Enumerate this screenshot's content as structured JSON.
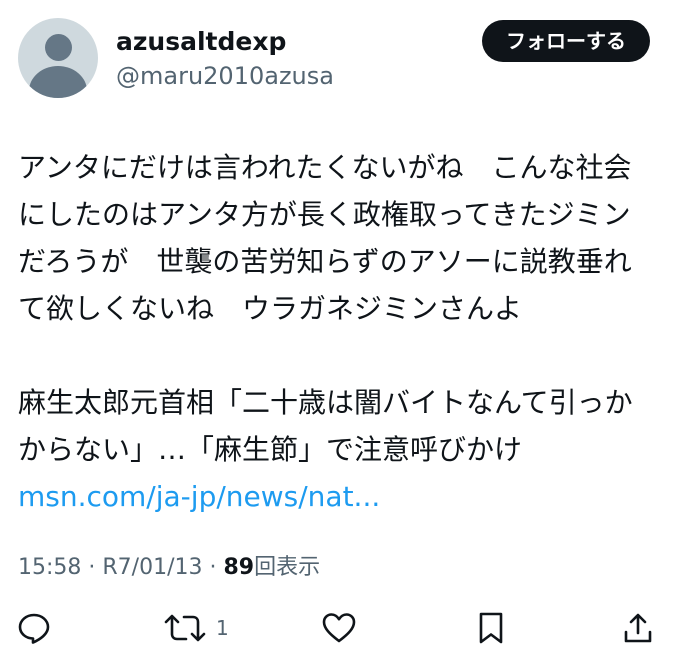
{
  "author": {
    "display_name": "azusaltdexp",
    "handle": "@maru2010azusa"
  },
  "follow_button": {
    "label": "フォローする"
  },
  "tweet": {
    "lines": [
      "アンタにだけは言われたくないがね　こんな社会",
      "にしたのはアンタ方が長く政権取ってきたジミン",
      "だろうが　世襲の苦労知らずのアソーに説教垂れ",
      "て欲しくないね　ウラガネジミンさんよ"
    ],
    "quote_lines": [
      "麻生太郎元首相「二十歳は闇バイトなんて引っか",
      "からない」…「麻生節」で注意呼びかけ"
    ],
    "link_text": "msn.com/ja-jp/news/nat..."
  },
  "meta": {
    "time": "15:58",
    "separator": " · ",
    "date": "R7/01/13",
    "views_count": "89",
    "views_label": "回表示"
  },
  "actions": {
    "retweet_count": "1"
  },
  "colors": {
    "text": "#0f1419",
    "secondary": "#536471",
    "link": "#1d9bf0",
    "button_bg": "#0f1419",
    "avatar_bg": "#cfd9de"
  },
  "icons": {
    "reply": "speech-bubble",
    "retweet": "loop-arrows",
    "like": "heart",
    "bookmark": "bookmark",
    "share": "upload-arrow"
  }
}
